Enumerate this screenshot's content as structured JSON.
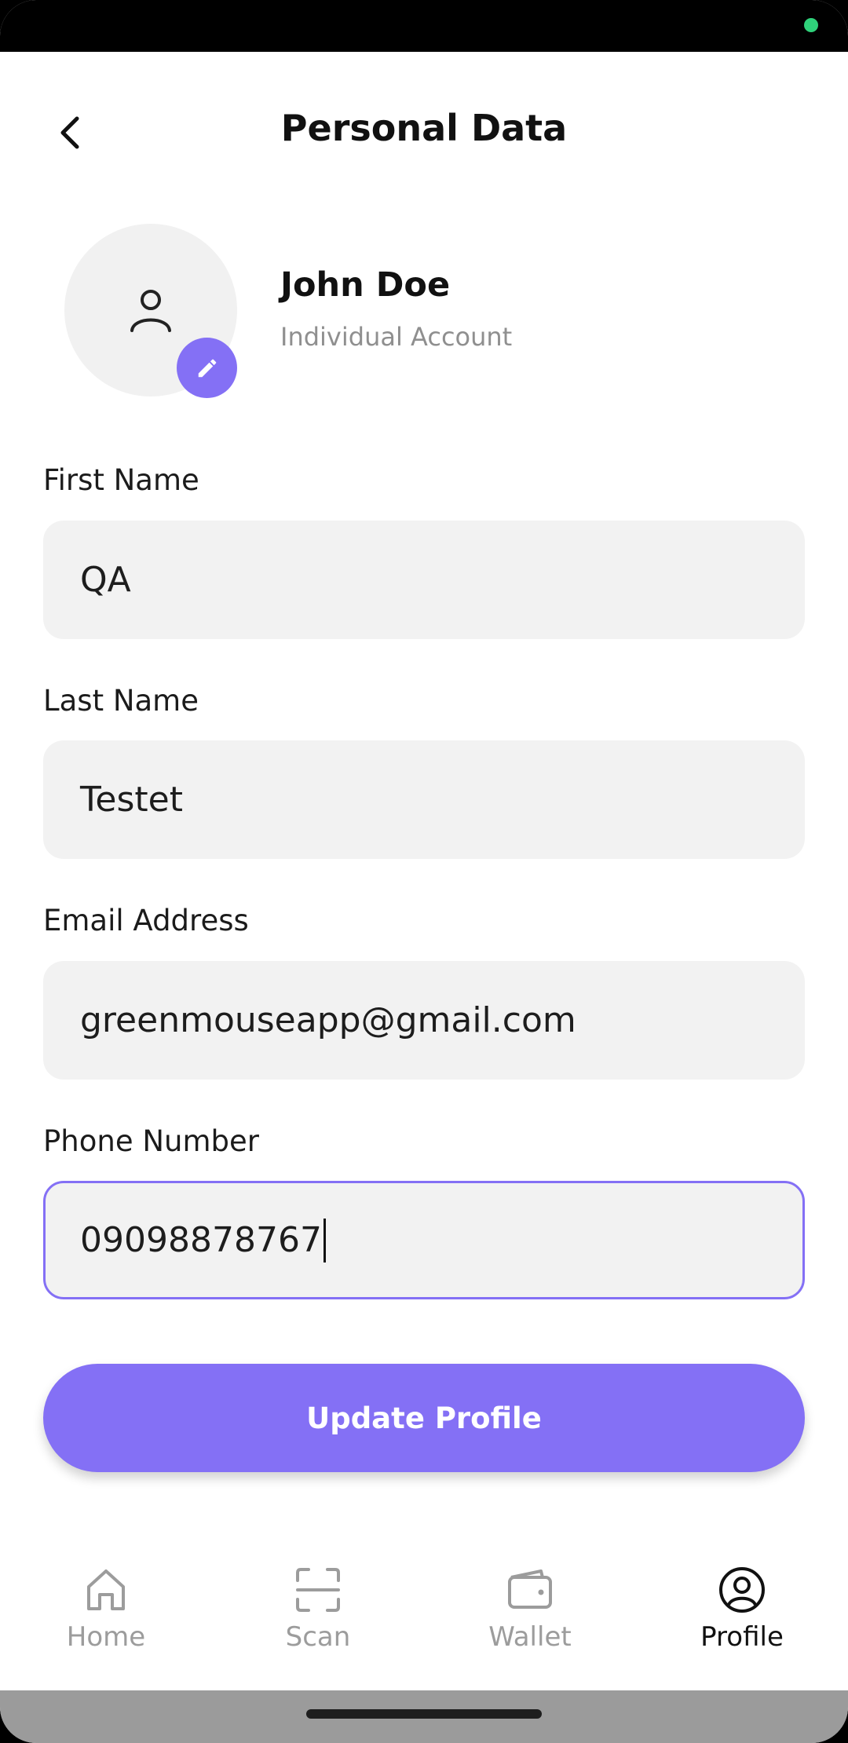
{
  "header": {
    "title": "Personal Data"
  },
  "profile": {
    "name": "John Doe",
    "account_type": "Individual Account"
  },
  "form": {
    "first_name": {
      "label": "First Name",
      "value": "QA"
    },
    "last_name": {
      "label": "Last Name",
      "value": "Testet"
    },
    "email": {
      "label": "Email Address",
      "value": "greenmouseapp@gmail.com"
    },
    "phone": {
      "label": "Phone Number",
      "value": "09098878767"
    }
  },
  "actions": {
    "update_label": "Update Profile"
  },
  "nav": {
    "items": [
      {
        "label": "Home",
        "icon": "home-icon",
        "active": false
      },
      {
        "label": "Scan",
        "icon": "scan-icon",
        "active": false
      },
      {
        "label": "Wallet",
        "icon": "wallet-icon",
        "active": false
      },
      {
        "label": "Profile",
        "icon": "profile-icon",
        "active": true
      }
    ]
  },
  "colors": {
    "accent": "#8470f5",
    "field_bg": "#f2f2f2",
    "status_dot": "#2fd17a"
  }
}
